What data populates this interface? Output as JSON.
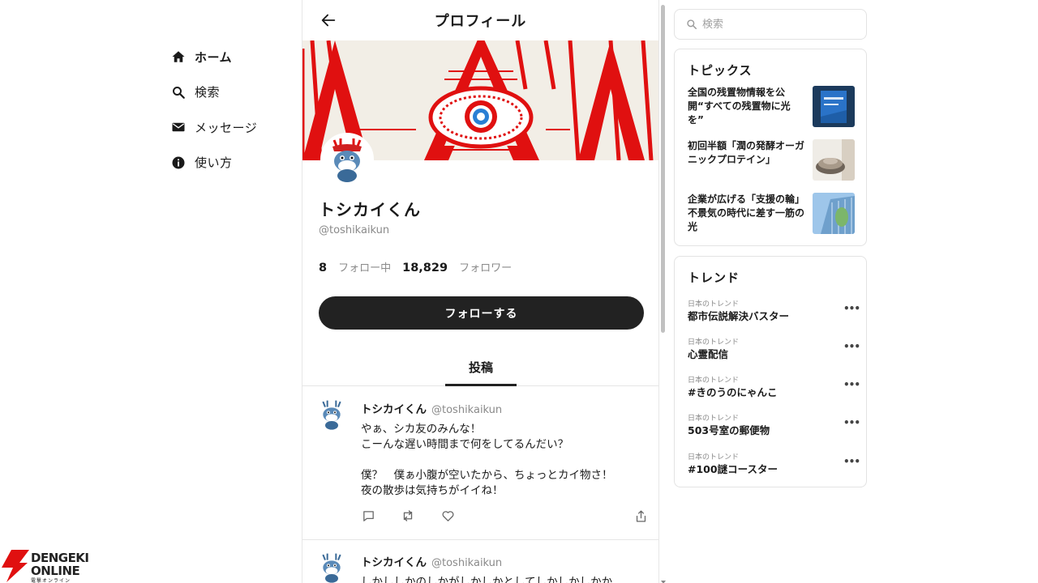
{
  "nav": {
    "items": [
      {
        "label": "ホーム",
        "icon": "home-icon"
      },
      {
        "label": "検索",
        "icon": "search-icon"
      },
      {
        "label": "メッセージ",
        "icon": "mail-icon"
      },
      {
        "label": "使い方",
        "icon": "info-icon"
      }
    ]
  },
  "header": {
    "title": "プロフィール"
  },
  "profile": {
    "name": "トシカイくん",
    "handle": "@toshikaikun",
    "following_count": "8",
    "following_label": "フォロー中",
    "followers_count": "18,829",
    "followers_label": "フォロワー",
    "follow_button": "フォローする"
  },
  "tabs": {
    "posts": "投稿"
  },
  "posts": [
    {
      "author": "トシカイくん",
      "handle": "@toshikaikun",
      "body": "やぁ、シカ友のみんな！\nこーんな遅い時間まで何をしてるんだい？\n\n僕？　僕ぁ小腹が空いたから、ちょっとカイ物さ！\n夜の散歩は気持ちがイイね！"
    },
    {
      "author": "トシカイくん",
      "handle": "@toshikaikun",
      "body": "しかししかのしかがしかしかとしてしかしかしかか"
    }
  ],
  "search": {
    "placeholder": "検索"
  },
  "topics": {
    "title": "トピックス",
    "items": [
      {
        "text": "全国の残置物情報を公開“すべての残置物に光を”"
      },
      {
        "text": "初回半額「潤の発酵オーガニックプロテイン」"
      },
      {
        "text": "企業が広げる「支援の輪」 不景気の時代に差す一筋の光"
      }
    ]
  },
  "trends": {
    "title": "トレンド",
    "items": [
      {
        "category": "日本のトレンド",
        "name": "都市伝説解決バスター",
        "more": "•••"
      },
      {
        "category": "日本のトレンド",
        "name": "心霊配信",
        "more": "•••"
      },
      {
        "category": "日本のトレンド",
        "name": "#きのうのにゃんこ",
        "more": "•••"
      },
      {
        "category": "日本のトレンド",
        "name": "503号室の郵便物",
        "more": "•••"
      },
      {
        "category": "日本のトレンド",
        "name": "#100謎コースター",
        "more": "•••"
      }
    ]
  },
  "watermark": {
    "line1": "DENGEKI",
    "line2": "ONLINE",
    "line3": "電撃オンライン"
  },
  "colors": {
    "accent": "#222222",
    "banner_red": "#e01010",
    "muted": "#8a8a8a"
  }
}
